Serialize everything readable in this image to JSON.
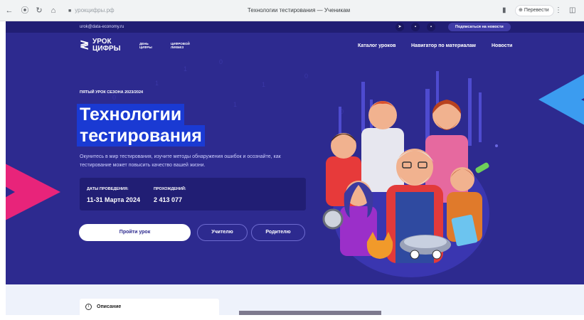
{
  "browser": {
    "url": "урокцифры.рф",
    "tab_title": "Технологии тестирования — Ученикам",
    "translate_label": "Перевести"
  },
  "topbar": {
    "email": "urok@data-economy.ru",
    "social": [
      "telegram-icon",
      "vk-icon",
      "ok-icon"
    ],
    "subscribe_label": "Подписаться на новости"
  },
  "logo": {
    "main_line1": "УРОК",
    "main_line2": "ЦИФРЫ",
    "partner1_line1": "ДЕНЬ",
    "partner1_line2": "ЦИФРЫ",
    "partner2_line1": "ЦИФРОВОЙ",
    "partner2_line2": "ЛИКБЕЗ"
  },
  "menu": {
    "catalog": "Каталог уроков",
    "navigator": "Навигатор по материалам",
    "news": "Новости"
  },
  "hero": {
    "season": "ПЯТЫЙ УРОК СЕЗОНА 2023/2024",
    "title_line1": "Технологии",
    "title_line2": "тестирования",
    "description": "Окунитесь в мир тестирования, изучите методы обнаружения ошибок и осознайте, как тестирование может повысить качество вашей жизни.",
    "dates_label": "ДАТЫ ПРОВЕДЕНИЯ:",
    "dates_value": "11-31 Марта 2024",
    "count_label": "ПРОХОЖДЕНИЙ:",
    "count_value": "2 413 077",
    "primary_button": "Пройти урок",
    "teacher_button": "Учителю",
    "parent_button": "Родителю"
  },
  "below": {
    "description_label": "Описание"
  },
  "colors": {
    "hero_bg": "#2d2a8f",
    "topbar_bg": "#211e74",
    "title_highlight": "#1a3ad3",
    "accent_pink": "#e8247a",
    "accent_blue": "#3b9cf0"
  }
}
